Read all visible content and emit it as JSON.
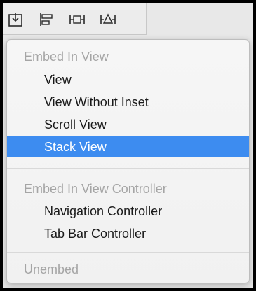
{
  "toolbar": {
    "icons": [
      {
        "name": "embed-in-icon"
      },
      {
        "name": "align-icon"
      },
      {
        "name": "pin-icon"
      },
      {
        "name": "resolve-issues-icon"
      }
    ]
  },
  "menu": {
    "embed_in_view_header": "Embed In View",
    "embed_in_view_items": [
      {
        "label": "View"
      },
      {
        "label": "View Without Inset"
      },
      {
        "label": "Scroll View"
      },
      {
        "label": "Stack View",
        "selected": true
      }
    ],
    "embed_in_controller_header": "Embed In View Controller",
    "embed_in_controller_items": [
      {
        "label": "Navigation Controller"
      },
      {
        "label": "Tab Bar Controller"
      }
    ],
    "unembed_label": "Unembed"
  },
  "colors": {
    "selection": "#3d8cf0",
    "header_text": "#a5a5a5",
    "menu_background": "#f4f4f4"
  }
}
